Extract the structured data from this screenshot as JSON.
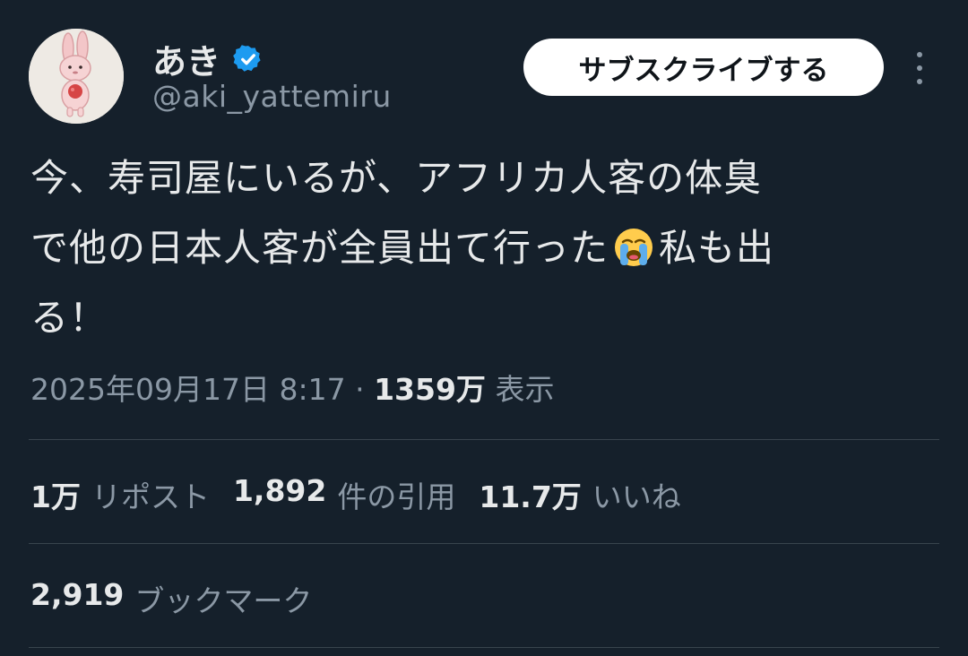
{
  "author": {
    "display_name": "あき",
    "handle": "@aki_yattemiru",
    "avatar_icon": "bunny-illustration-avatar",
    "verified_icon": "verified-badge-icon",
    "verified_color": "#1d9bf0"
  },
  "actions": {
    "subscribe_label": "サブスクライブする",
    "more_icon": "more-options-icon"
  },
  "tweet": {
    "line1": "今、寿司屋にいるが、アフリカ人客の体臭",
    "line2_before_emoji": "で他の日本人客が全員出て行った",
    "emoji": "loudly-crying-face-emoji",
    "line2_after_emoji": "私も出",
    "line3": "る！"
  },
  "meta": {
    "date": "2025年09月17日",
    "time": "8:17",
    "separator": "·",
    "views_count": "1359万",
    "views_label": "表示"
  },
  "stats": {
    "reposts_count": "1万",
    "reposts_label": "リポスト",
    "quotes_count": "1,892",
    "quotes_label": "件の引用",
    "likes_count": "11.7万",
    "likes_label": "いいね"
  },
  "bookmarks": {
    "count": "2,919",
    "label": "ブックマーク"
  },
  "colors": {
    "background": "#15202b",
    "primary_text": "#e7e9ea",
    "secondary_text": "#8b98a5",
    "divider": "#38444d"
  }
}
